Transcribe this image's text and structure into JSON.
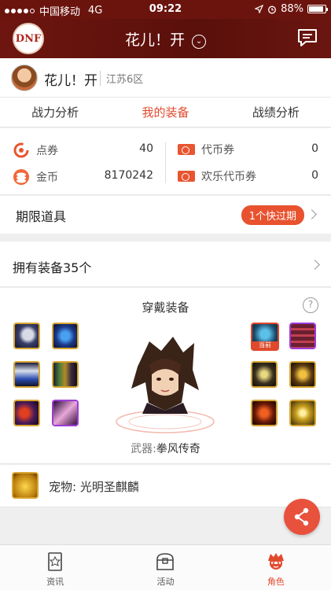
{
  "status_bar": {
    "carrier": "中国移动",
    "network": "4G",
    "time": "09:22",
    "battery": "88%",
    "battery_level": 0.88
  },
  "nav": {
    "logo_text": "DNF",
    "title": "花儿！开",
    "chevron": "⌄"
  },
  "profile": {
    "name": "花儿！开",
    "server": "江苏6区"
  },
  "tabs": [
    {
      "label": "战力分析",
      "active": false
    },
    {
      "label": "我的装备",
      "active": true
    },
    {
      "label": "战绩分析",
      "active": false
    }
  ],
  "currency": {
    "points_label": "点券",
    "points_value": "40",
    "gold_label": "金币",
    "gold_value": "8170242",
    "voucher_label": "代币券",
    "voucher_value": "0",
    "happy_voucher_label": "欢乐代币券",
    "happy_voucher_value": "0"
  },
  "limited_items": {
    "label": "期限道具",
    "badge": "1个快过期"
  },
  "owned_equipment": {
    "label": "拥有装备35个"
  },
  "equipment": {
    "title": "穿戴装备",
    "help": "?",
    "current_tag": "当前",
    "weapon_prefix": "武器:",
    "weapon_name": "拳风传奇"
  },
  "pet": {
    "label": "宠物: 光明圣麒麟"
  },
  "tabbar": [
    {
      "label": "资讯",
      "icon": "news-icon",
      "active": false
    },
    {
      "label": "活动",
      "icon": "chest-icon",
      "active": false
    },
    {
      "label": "角色",
      "icon": "character-icon",
      "active": true
    }
  ],
  "colors": {
    "brand_dark": "#6b140e",
    "accent": "#e14a2d",
    "gold_border": "#d8a632",
    "purple_border": "#9d3bd8"
  }
}
